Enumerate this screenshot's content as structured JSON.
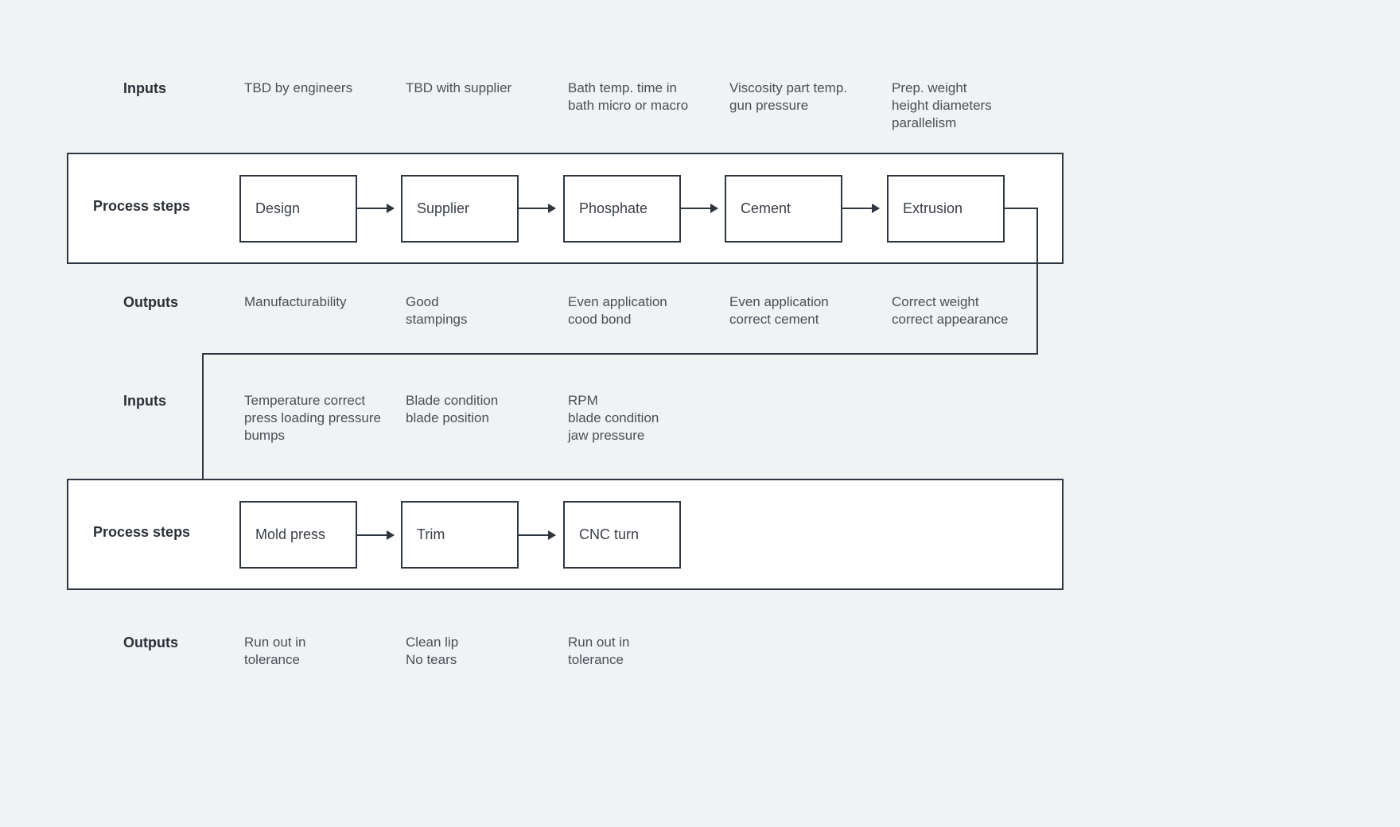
{
  "labels": {
    "inputs": "Inputs",
    "process_steps": "Process\nsteps",
    "outputs": "Outputs"
  },
  "row1": {
    "inputs": [
      "TBD by engineers",
      "TBD with supplier",
      "Bath temp. time in\nbath micro or macro",
      "Viscosity part temp.\ngun pressure",
      "Prep. weight\nheight diameters\nparallelism"
    ],
    "steps": [
      "Design",
      "Supplier",
      "Phosphate",
      "Cement",
      "Extrusion"
    ],
    "outputs": [
      "Manufacturability",
      "Good\nstampings",
      "Even application\ncood bond",
      "Even application\ncorrect cement",
      "Correct weight\ncorrect appearance"
    ]
  },
  "row2": {
    "inputs": [
      "Temperature correct\npress loading pressure\nbumps",
      "Blade condition\nblade position",
      "RPM\nblade condition\njaw pressure"
    ],
    "steps": [
      "Mold press",
      "Trim",
      "CNC turn"
    ],
    "outputs": [
      "Run out in\ntolerance",
      "Clean lip\nNo tears",
      "Run out in\ntolerance"
    ]
  }
}
